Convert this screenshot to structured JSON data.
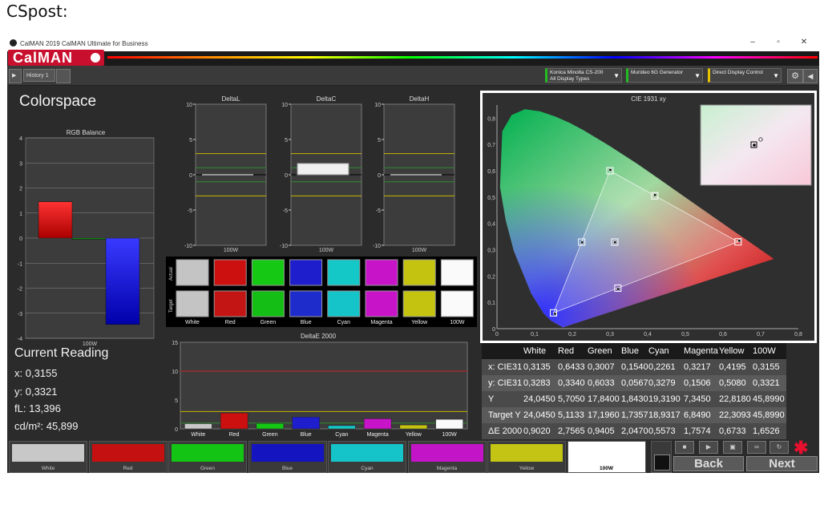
{
  "caption": "CSpost:",
  "window": {
    "title": "CalMAN 2019 CalMAN Ultimate for Business",
    "minimize": "–",
    "maximize": "▫",
    "close": "✕"
  },
  "logo": "CalMAN",
  "toolbar": {
    "history_tab": "History 1",
    "devices": [
      {
        "line1": "Konica Minolta CS-200",
        "line2": "All Display Types",
        "accent": "#22bb22"
      },
      {
        "line1": "Murideo 6G Generator",
        "line2": "",
        "accent": "#22bb22"
      },
      {
        "line1": "Direct Display Control",
        "line2": "",
        "accent": "#e6c200"
      }
    ]
  },
  "page_title": "Colorspace",
  "rgb_balance": {
    "title": "RGB Balance",
    "yticks": [
      "4",
      "3",
      "2",
      "1",
      "0",
      "-1",
      "-2",
      "-3",
      "-4"
    ],
    "xlabel": "100W",
    "chart_data": {
      "type": "bar",
      "categories": [
        "Red",
        "Green",
        "Blue"
      ],
      "values": [
        1.45,
        -0.05,
        -3.45
      ],
      "ylim": [
        -4,
        4
      ]
    }
  },
  "delta_charts": [
    {
      "title": "DeltaL",
      "xlabel": "100W",
      "yticks": [
        "10",
        "5",
        "0",
        "-5",
        "-10"
      ]
    },
    {
      "title": "DeltaC",
      "xlabel": "100W",
      "yticks": [
        "10",
        "5",
        "0",
        "-5",
        "-10"
      ]
    },
    {
      "title": "DeltaH",
      "xlabel": "100W",
      "yticks": [
        "10",
        "5",
        "0",
        "-5",
        "-10"
      ]
    }
  ],
  "delta_chart_data": {
    "type": "bar",
    "categories": [
      "100W"
    ],
    "series": [
      {
        "name": "DeltaL",
        "values": [
          0
        ]
      },
      {
        "name": "DeltaC",
        "values": [
          1.6
        ]
      },
      {
        "name": "DeltaH",
        "values": [
          0
        ]
      }
    ],
    "ylim": [
      -10,
      10
    ]
  },
  "swatches": {
    "row_labels": [
      "Actual",
      "Target"
    ],
    "items": [
      {
        "name": "White",
        "actual": "#c4c4c4",
        "target": "#c4c4c4"
      },
      {
        "name": "Red",
        "actual": "#cc1010",
        "target": "#c41515"
      },
      {
        "name": "Green",
        "actual": "#14c814",
        "target": "#14be14"
      },
      {
        "name": "Blue",
        "actual": "#1e1ecc",
        "target": "#1e2ccc"
      },
      {
        "name": "Cyan",
        "actual": "#14c8c8",
        "target": "#14c4c8"
      },
      {
        "name": "Magenta",
        "actual": "#c814c8",
        "target": "#c814c8"
      },
      {
        "name": "Yellow",
        "actual": "#c4c410",
        "target": "#c4c410"
      },
      {
        "name": "100W",
        "actual": "#fafafa",
        "target": "#fafafa"
      }
    ]
  },
  "deltae": {
    "title": "DeltaE 2000",
    "yticks": [
      "15",
      "10",
      "5",
      "0"
    ],
    "chart_data": {
      "type": "bar",
      "categories": [
        "White",
        "Red",
        "Green",
        "Blue",
        "Cyan",
        "Magenta",
        "Yellow",
        "100W"
      ],
      "values": [
        0.902,
        2.7565,
        0.9405,
        2.047,
        0.5573,
        1.7574,
        0.6733,
        1.6526
      ],
      "ylim": [
        0,
        15
      ]
    },
    "bar_colors": [
      "#c8c8c8",
      "#cc1010",
      "#14c814",
      "#1e1ecc",
      "#14c8c8",
      "#c814c8",
      "#c4c410",
      "#fafafa"
    ]
  },
  "current_reading": {
    "title": "Current Reading",
    "x": "x: 0,3155",
    "y": "y: 0,3321",
    "fl": "fL: 13,396",
    "cd": "cd/m²: 45,899"
  },
  "cie": {
    "title": "CIE 1931 xy",
    "xticks": [
      "0",
      "0,1",
      "0,2",
      "0,3",
      "0,4",
      "0,5",
      "0,6",
      "0,7",
      "0,8"
    ],
    "yticks": [
      "0,8",
      "0,7",
      "0,6",
      "0,5",
      "0,4",
      "0,3",
      "0,2",
      "0,1",
      "0"
    ],
    "chart_data": {
      "type": "scatter",
      "targets": [
        {
          "name": "Red",
          "x": 0.64,
          "y": 0.33
        },
        {
          "name": "Green",
          "x": 0.3,
          "y": 0.6
        },
        {
          "name": "Blue",
          "x": 0.15,
          "y": 0.06
        },
        {
          "name": "Cyan",
          "x": 0.225,
          "y": 0.329
        },
        {
          "name": "Magenta",
          "x": 0.321,
          "y": 0.154
        },
        {
          "name": "Yellow",
          "x": 0.419,
          "y": 0.505
        },
        {
          "name": "White",
          "x": 0.3127,
          "y": 0.329
        }
      ],
      "measured": [
        {
          "name": "Red",
          "x": 0.6433,
          "y": 0.334
        },
        {
          "name": "Green",
          "x": 0.3007,
          "y": 0.6033
        },
        {
          "name": "Blue",
          "x": 0.154,
          "y": 0.0567
        },
        {
          "name": "Cyan",
          "x": 0.2261,
          "y": 0.3279
        },
        {
          "name": "Magenta",
          "x": 0.3217,
          "y": 0.1506
        },
        {
          "name": "Yellow",
          "x": 0.4195,
          "y": 0.508
        },
        {
          "name": "White",
          "x": 0.3135,
          "y": 0.3283
        }
      ],
      "xlim": [
        0,
        0.8
      ],
      "ylim": [
        0,
        0.85
      ]
    }
  },
  "table": {
    "headers": [
      "",
      "White",
      "Red",
      "Green",
      "Blue",
      "Cyan",
      "Magenta",
      "Yellow",
      "100W"
    ],
    "rows": [
      [
        "x: CIE31",
        "0,3135",
        "0,6433",
        "0,3007",
        "0,1540",
        "0,2261",
        "0,3217",
        "0,4195",
        "0,3155"
      ],
      [
        "y: CIE31",
        "0,3283",
        "0,3340",
        "0,6033",
        "0,0567",
        "0,3279",
        "0,1506",
        "0,5080",
        "0,3321"
      ],
      [
        "Y",
        "24,0450",
        "5,7050",
        "17,8400",
        "1,8430",
        "19,3190",
        "7,3450",
        "22,8180",
        "45,8990"
      ],
      [
        "Target Y",
        "24,0450",
        "5,1133",
        "17,1960",
        "1,7357",
        "18,9317",
        "6,8490",
        "22,3093",
        "45,8990"
      ],
      [
        "ΔE 2000",
        "0,9020",
        "2,7565",
        "0,9405",
        "2,0470",
        "0,5573",
        "1,7574",
        "0,6733",
        "1,6526"
      ]
    ]
  },
  "bottom_swatches": [
    {
      "label": "White",
      "color": "#c8c8c8"
    },
    {
      "label": "Red",
      "color": "#c41010"
    },
    {
      "label": "Green",
      "color": "#14c414"
    },
    {
      "label": "Blue",
      "color": "#1414c0"
    },
    {
      "label": "Cyan",
      "color": "#14c4c8"
    },
    {
      "label": "Magenta",
      "color": "#c414c8"
    },
    {
      "label": "Yellow",
      "color": "#c4c414"
    },
    {
      "label": "100W",
      "color": "#ffffff"
    }
  ],
  "nav": {
    "back": "Back",
    "next": "Next"
  }
}
